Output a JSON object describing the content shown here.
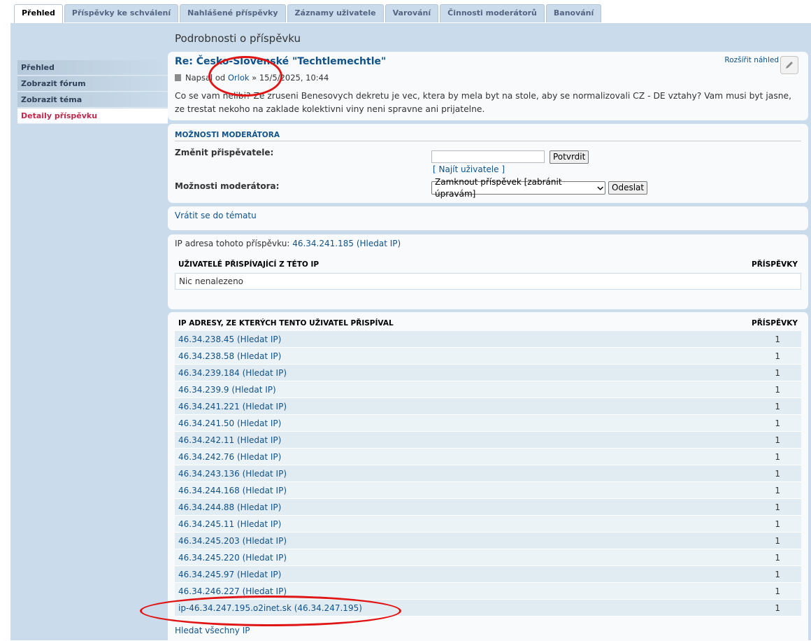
{
  "tabs": [
    "Přehled",
    "Příspěvky ke schválení",
    "Nahlášené příspěvky",
    "Záznamy uživatele",
    "Varování",
    "Činnosti moderátorů",
    "Banování"
  ],
  "sidebar": [
    "Přehled",
    "Zobrazit fórum",
    "Zobrazit téma",
    "Detaily příspěvku"
  ],
  "page_title": "Podrobnosti o příspěvku",
  "post": {
    "title": "Re: Česko-Slovenské \"Techtlemechtle\"",
    "written_by": "Napsal od",
    "author": "Orlok",
    "date": "» 15/5/2025, 10:44",
    "body": "Co se vam nelibi? Ze zruseni Benesovych dekretu je vec, ktera by mela byt na stole, aby se normalizovali CZ - DE vztahy? Vam musi byt jasne, ze trestat nekoho na zaklade kolektivni viny neni spravne ani prijatelne.",
    "expand": "Rozšířit náhled"
  },
  "mod": {
    "heading": "MOŽNOSTI MODERÁTORA",
    "change_label": "Změnit přispěvatele:",
    "confirm": "Potvrdit",
    "find_user": "[ Najít uživatele ]",
    "options_label": "Možnosti moderátora:",
    "select_value": "Zamknout příspěvek [zabránit úpravám]",
    "submit": "Odeslat"
  },
  "back_link": "Vrátit se do tématu",
  "ip_info": {
    "label": "IP adresa tohoto příspěvku:",
    "ip": "46.34.241.185",
    "search": "(Hledat IP)"
  },
  "users_table": {
    "col1": "UŽIVATELÉ PŘISPÍVAJÍCÍ Z TÉTO IP",
    "col2": "PŘÍSPĚVKY",
    "empty": "Nic nenalezeno"
  },
  "ips_table": {
    "col1": "IP ADRESY, ZE KTERÝCH TENTO UŽIVATEL PŘISPÍVAL",
    "col2": "PŘÍSPĚVKY",
    "rows": [
      {
        "ip": "46.34.238.45",
        "search": "(Hledat IP)",
        "count": "1"
      },
      {
        "ip": "46.34.238.58",
        "search": "(Hledat IP)",
        "count": "1"
      },
      {
        "ip": "46.34.239.184",
        "search": "(Hledat IP)",
        "count": "1"
      },
      {
        "ip": "46.34.239.9",
        "search": "(Hledat IP)",
        "count": "1"
      },
      {
        "ip": "46.34.241.221",
        "search": "(Hledat IP)",
        "count": "1"
      },
      {
        "ip": "46.34.241.50",
        "search": "(Hledat IP)",
        "count": "1"
      },
      {
        "ip": "46.34.242.11",
        "search": "(Hledat IP)",
        "count": "1"
      },
      {
        "ip": "46.34.242.76",
        "search": "(Hledat IP)",
        "count": "1"
      },
      {
        "ip": "46.34.243.136",
        "search": "(Hledat IP)",
        "count": "1"
      },
      {
        "ip": "46.34.244.168",
        "search": "(Hledat IP)",
        "count": "1"
      },
      {
        "ip": "46.34.244.88",
        "search": "(Hledat IP)",
        "count": "1"
      },
      {
        "ip": "46.34.245.11",
        "search": "(Hledat IP)",
        "count": "1"
      },
      {
        "ip": "46.34.245.203",
        "search": "(Hledat IP)",
        "count": "1"
      },
      {
        "ip": "46.34.245.220",
        "search": "(Hledat IP)",
        "count": "1"
      },
      {
        "ip": "46.34.245.97",
        "search": "(Hledat IP)",
        "count": "1"
      },
      {
        "ip": "46.34.246.227",
        "search": "(Hledat IP)",
        "count": "1"
      },
      {
        "ip": "ip-46.34.247.195.o2inet.sk",
        "search": "(46.34.247.195)",
        "count": "1"
      }
    ]
  },
  "search_all": "Hledat všechny IP",
  "colors": {
    "link": "#105289",
    "active": "#bc2a4d",
    "annotation": "#e01515"
  }
}
